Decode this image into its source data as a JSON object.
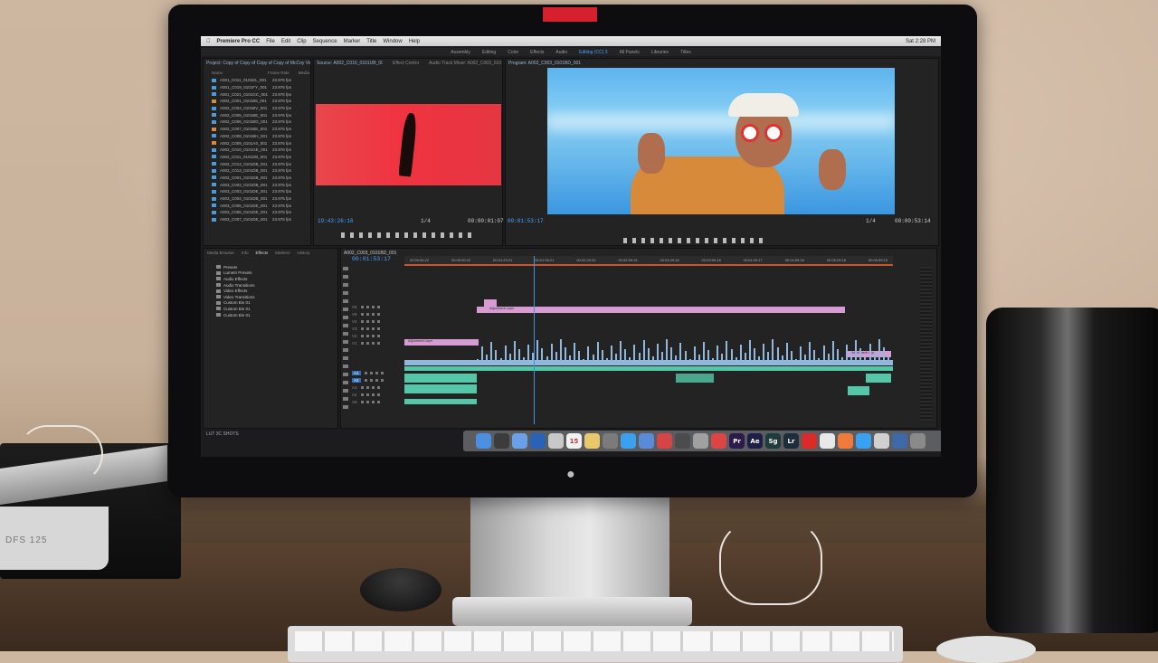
{
  "app": {
    "name": "Premiere Pro CC",
    "menus": [
      "File",
      "Edit",
      "Clip",
      "Sequence",
      "Marker",
      "Title",
      "Window",
      "Help"
    ],
    "clock": "Sat 2:28 PM"
  },
  "workspaces": [
    "Assembly",
    "Editing",
    "Color",
    "Effects",
    "Audio",
    "Titles",
    "Libraries",
    "All Panels",
    "Editing (CC) 3"
  ],
  "project": {
    "title": "Project: Copy of Copy of Copy of Copy of McCoy Video",
    "columns": [
      "Name",
      "Frame Rate",
      "Media"
    ],
    "items": [
      {
        "name": "A001_C011_0101EL_001",
        "rate": "23.976 fps"
      },
      {
        "name": "A001_C019_0101FY_001",
        "rate": "23.976 fps"
      },
      {
        "name": "A001_C021_0101GC_001",
        "rate": "23.976 fps"
      },
      {
        "name": "A002_C001_0101B6_001",
        "rate": "23.976 fps"
      },
      {
        "name": "A002_C004_0101BV_001",
        "rate": "23.976 fps"
      },
      {
        "name": "A002_C005_0101BE_001",
        "rate": "23.976 fps"
      },
      {
        "name": "A002_C006_0101BG_001",
        "rate": "23.976 fps"
      },
      {
        "name": "A002_C007_0101BE_001",
        "rate": "23.976 fps"
      },
      {
        "name": "A002_C008_0101BH_001",
        "rate": "23.976 fps"
      },
      {
        "name": "A002_C009_0101AS_001",
        "rate": "23.976 fps"
      },
      {
        "name": "A002_C010_0101GE_001",
        "rate": "23.976 fps"
      },
      {
        "name": "A002_C011_0101DB_001",
        "rate": "23.976 fps"
      },
      {
        "name": "A002_C012_0101DB_001",
        "rate": "23.976 fps"
      },
      {
        "name": "A002_C013_0101DB_001",
        "rate": "23.976 fps"
      },
      {
        "name": "A002_C001_0101DB_001",
        "rate": "23.976 fps"
      },
      {
        "name": "A003_C002_0101DB_001",
        "rate": "23.976 fps"
      },
      {
        "name": "A003_C003_0101DE_001",
        "rate": "23.976 fps"
      },
      {
        "name": "A003_C004_0101DB_001",
        "rate": "23.976 fps"
      },
      {
        "name": "A003_C005_0101DE_001",
        "rate": "23.976 fps"
      },
      {
        "name": "A003_C006_0101DE_001",
        "rate": "23.976 fps"
      },
      {
        "name": "A003_C007_0101DE_001",
        "rate": "23.976 fps"
      }
    ]
  },
  "source": {
    "tab": "Source: A002_C016_0101UB_001.R3D",
    "tabs2": [
      "Effect Controls",
      "Audio Track Mixer: A002_C003_0101BD_00"
    ],
    "timecode_in": "19:43:26:16",
    "timecode_out": "00:00:01:07",
    "fraction": "1/4"
  },
  "program": {
    "tab": "Program: A002_C003_0101BD_001",
    "timecode_in": "00:01:53:17",
    "timecode_out": "00:00:53:14",
    "fraction": "1/4"
  },
  "effects": {
    "tabs": [
      "Media Browser",
      "Info",
      "Effects",
      "Markers",
      "History"
    ],
    "items": [
      "Presets",
      "Lumetri Presets",
      "Audio Effects",
      "Audio Transitions",
      "Video Effects",
      "Video Transitions",
      "Custom Bin 01",
      "Custom Bin 01",
      "Custom Bin 01"
    ]
  },
  "timeline": {
    "tab": "A002_C003_0101BD_001",
    "timecode": "00:01:53:17",
    "ruler": [
      "00:00:54:22",
      "00:00:59:22",
      "00:01:29:21",
      "00:01:59:21",
      "00:02:29:20",
      "00:02:59:19",
      "00:03:29:18",
      "00:03:59:18",
      "00:04:29:17",
      "00:04:59:16",
      "00:05:29:16",
      "00:05:59:15"
    ],
    "adjustment_label": "Adjustment Layer",
    "video_tracks": [
      "V6",
      "V5",
      "V4",
      "V3",
      "V2",
      "V1"
    ],
    "audio_tracks": [
      "A1",
      "A2",
      "A3",
      "A4",
      "A5"
    ]
  },
  "status": "LUT 3C SHOTS",
  "dock": [
    {
      "label": "",
      "color": "#4a8fe0"
    },
    {
      "label": "",
      "color": "#3c3c3c"
    },
    {
      "label": "",
      "color": "#6aa0e8"
    },
    {
      "label": "",
      "color": "#2a62b8"
    },
    {
      "label": "",
      "color": "#c8c8c8"
    },
    {
      "label": "15",
      "color": "#f2f2f2"
    },
    {
      "label": "",
      "color": "#e8c86b"
    },
    {
      "label": "",
      "color": "#7b7b7b"
    },
    {
      "label": "",
      "color": "#3aa0f0"
    },
    {
      "label": "",
      "color": "#5a8ad8"
    },
    {
      "label": "",
      "color": "#d64545"
    },
    {
      "label": "",
      "color": "#4c4c4c"
    },
    {
      "label": "",
      "color": "#a0a0a0"
    },
    {
      "label": "",
      "color": "#d44"
    },
    {
      "label": "Pr",
      "color": "#2d1a4c"
    },
    {
      "label": "Ae",
      "color": "#1e1e4a"
    },
    {
      "label": "Sg",
      "color": "#1e3c3c"
    },
    {
      "label": "Lr",
      "color": "#1e2d3c"
    },
    {
      "label": "",
      "color": "#da2a2a"
    },
    {
      "label": "",
      "color": "#e8e8e8"
    },
    {
      "label": "",
      "color": "#f07a3a"
    },
    {
      "label": "",
      "color": "#3aa0f0"
    },
    {
      "label": "",
      "color": "#d0d0d0"
    },
    {
      "label": "",
      "color": "#3c6aa8"
    },
    {
      "label": "",
      "color": "#8a8a8a"
    }
  ],
  "printer_label": "DFS 125"
}
